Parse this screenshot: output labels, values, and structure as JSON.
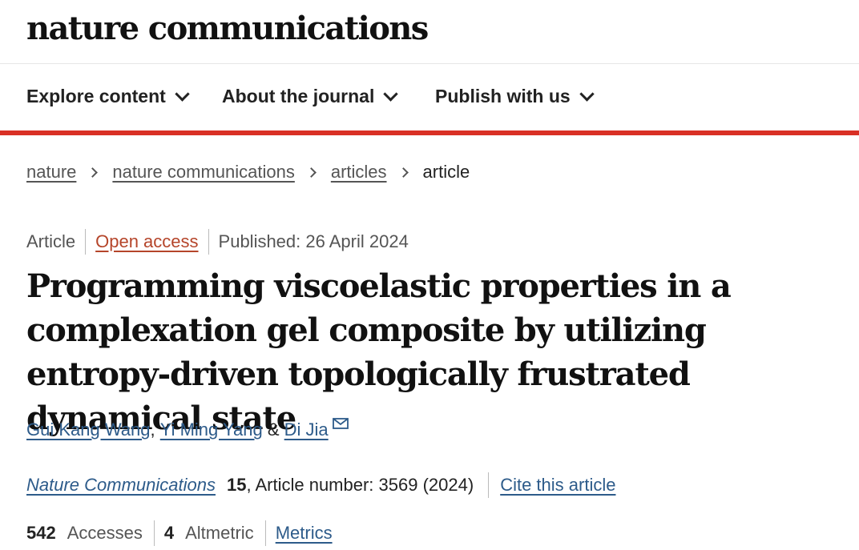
{
  "header": {
    "logo": "nature communications"
  },
  "nav": {
    "items": [
      {
        "label": "Explore content"
      },
      {
        "label": "About the journal"
      },
      {
        "label": "Publish with us"
      }
    ]
  },
  "breadcrumb": {
    "items": [
      {
        "label": "nature"
      },
      {
        "label": "nature communications"
      },
      {
        "label": "articles"
      }
    ],
    "current": "article"
  },
  "meta": {
    "type": "Article",
    "access": "Open access",
    "published": "Published: 26 April 2024"
  },
  "article": {
    "title": "Programming viscoelastic properties in a complexation gel composite by utilizing entropy-driven topologically frustrated dynamical state",
    "authors": [
      "Gui Kang Wang",
      "Yi Ming Yang",
      "Di Jia"
    ],
    "author_separator": ", ",
    "author_and": " & ",
    "journal": "Nature Communications",
    "volume": "15",
    "article_number": ", Article number: 3569 (2024)",
    "cite_label": "Cite this article"
  },
  "metrics": {
    "accesses_count": "542",
    "accesses_label": "Accesses",
    "altmetric_count": "4",
    "altmetric_label": "Altmetric",
    "metrics_link": "Metrics"
  },
  "colors": {
    "accent_red": "#d93025",
    "link_blue": "#2d5b8a",
    "open_access": "#b5452a"
  },
  "icons": {
    "nav_chevron": "chevron-down-icon",
    "breadcrumb_sep": "chevron-right-icon",
    "author_email": "mail-icon"
  }
}
